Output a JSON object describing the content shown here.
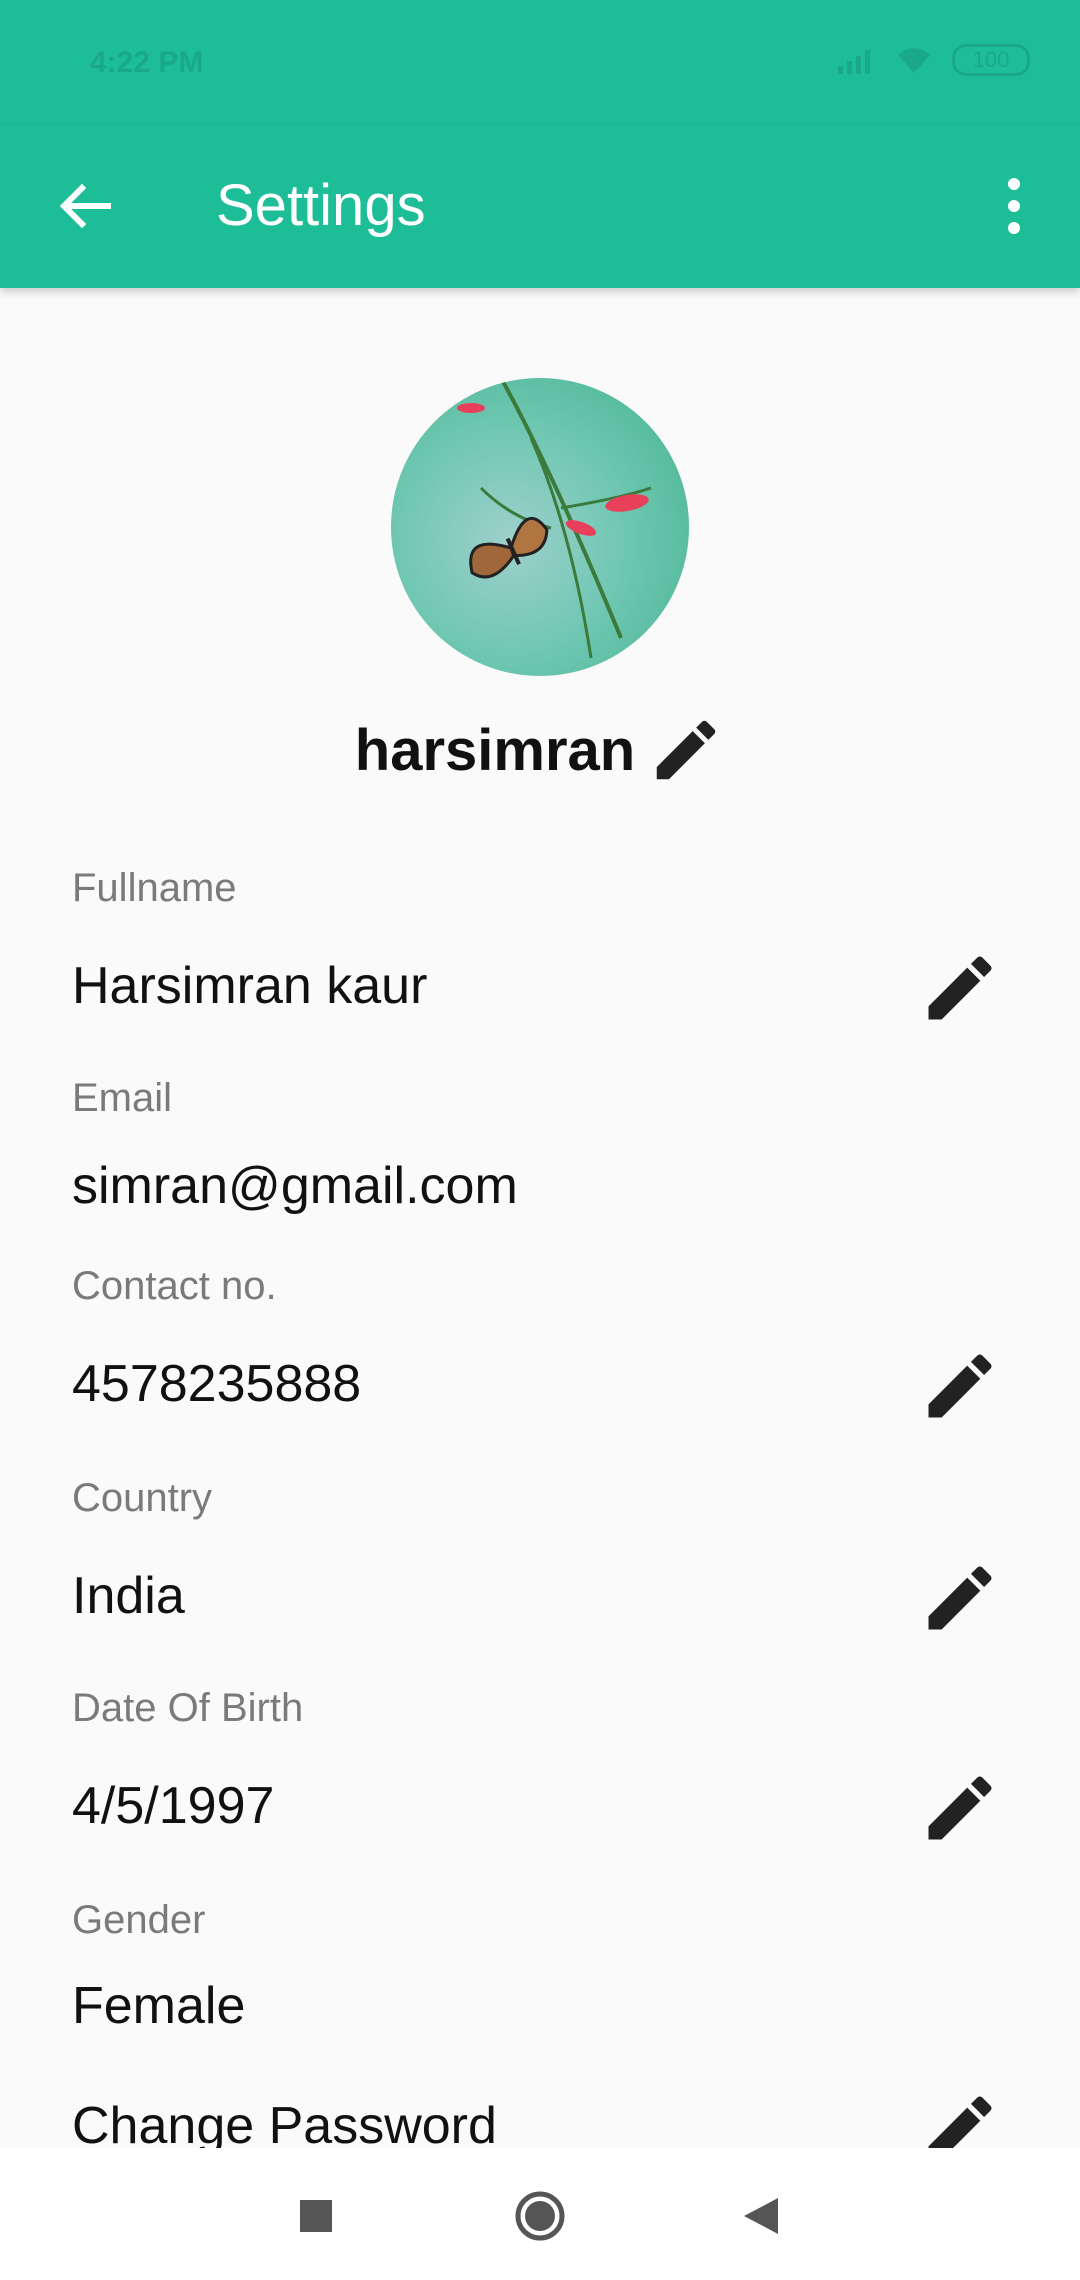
{
  "status_bar": {
    "time": "4:22 PM",
    "battery": "100",
    "icons": [
      "signal-icon",
      "wifi-icon",
      "battery-icon"
    ]
  },
  "toolbar": {
    "title": "Settings",
    "back_icon": "arrow-left-icon",
    "more_icon": "more-vert-icon",
    "background": "#1dbd98"
  },
  "profile": {
    "username": "harsimran",
    "avatar": "butterfly-photo"
  },
  "fields": [
    {
      "label": "Fullname",
      "value": "Harsimran kaur",
      "editable": true
    },
    {
      "label": "Email",
      "value": "simran@gmail.com",
      "editable": false
    },
    {
      "label": "Contact no.",
      "value": "4578235888",
      "editable": true
    },
    {
      "label": "Country",
      "value": "India",
      "editable": true
    },
    {
      "label": "Date Of Birth",
      "value": "4/5/1997",
      "editable": true
    },
    {
      "label": "Gender",
      "value": "Female",
      "editable": false
    }
  ],
  "change_password": {
    "label": "Change Password"
  },
  "nav": {
    "recents": "square-icon",
    "home": "circle-icon",
    "back": "triangle-back-icon"
  }
}
